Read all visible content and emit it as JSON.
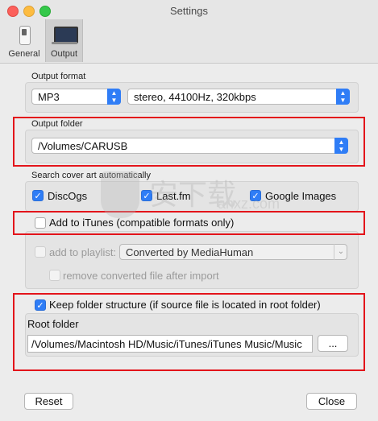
{
  "window": {
    "title": "Settings"
  },
  "toolbar": {
    "tabs": [
      {
        "label": "General",
        "icon": "toggle-switch-icon",
        "selected": false
      },
      {
        "label": "Output",
        "icon": "laptop-icon",
        "selected": true
      }
    ]
  },
  "output_format": {
    "label": "Output format",
    "format_value": "MP3",
    "quality_value": "stereo, 44100Hz, 320kbps"
  },
  "output_folder": {
    "label": "Output folder",
    "value": "/Volumes/CARUSB"
  },
  "cover_art": {
    "label": "Search cover art automatically",
    "sources": [
      {
        "label": "DiscOgs",
        "checked": true
      },
      {
        "label": "Last.fm",
        "checked": true
      },
      {
        "label": "Google Images",
        "checked": true
      }
    ]
  },
  "itunes": {
    "add_label": "Add to iTunes (compatible formats only)",
    "add_checked": false,
    "playlist_label": "add to playlist:",
    "playlist_checked": false,
    "playlist_value": "Converted by MediaHuman",
    "remove_label": "remove converted file after import",
    "remove_checked": false
  },
  "folder_structure": {
    "keep_label": "Keep folder structure (if source file is located in root folder)",
    "keep_checked": true,
    "root_label": "Root folder",
    "root_value": "/Volumes/Macintosh HD/Music/iTunes/iTunes Music/Music",
    "browse_label": "..."
  },
  "footer": {
    "reset_label": "Reset",
    "close_label": "Close"
  },
  "watermark": {
    "text": "安下载",
    "domain": "anxz.com"
  },
  "colors": {
    "accent": "#2f7df6",
    "highlight_box": "#e3141b"
  }
}
